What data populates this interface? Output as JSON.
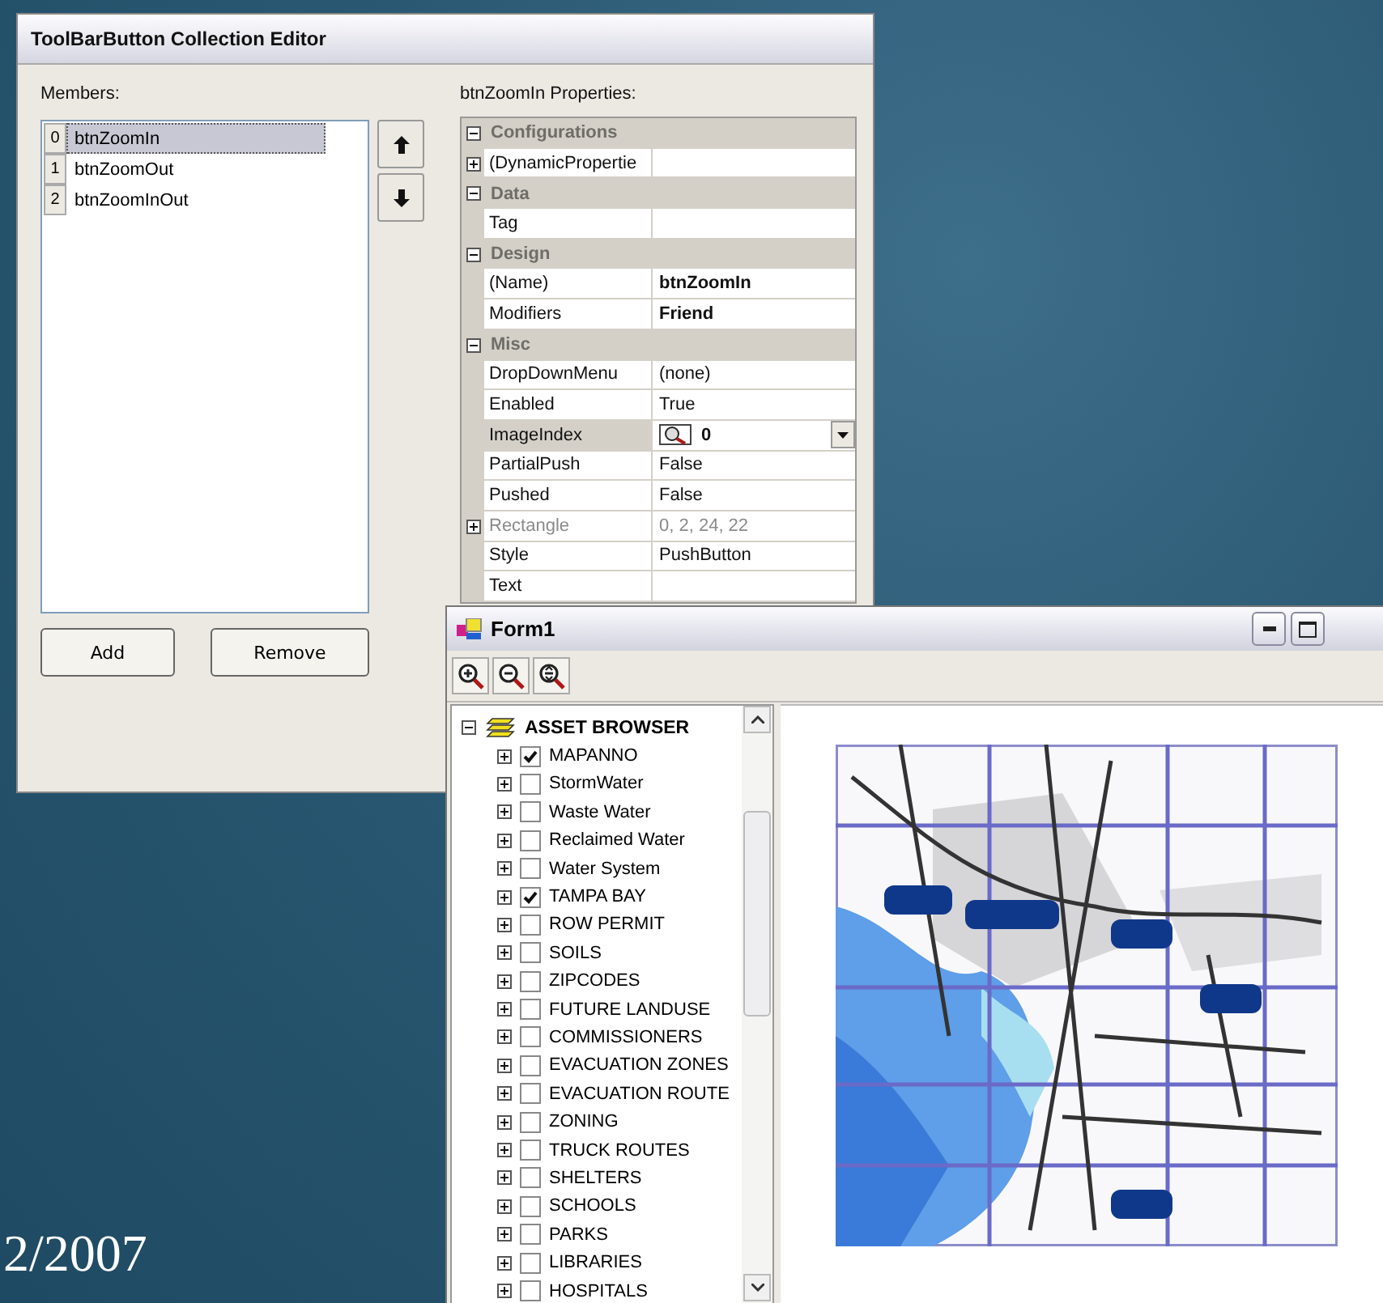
{
  "slide": {
    "date": "2/2007"
  },
  "editor": {
    "title": "ToolBarButton Collection Editor",
    "members_label": "Members:",
    "members": [
      {
        "index": "0",
        "name": "btnZoomIn",
        "selected": true
      },
      {
        "index": "1",
        "name": "btnZoomOut",
        "selected": false
      },
      {
        "index": "2",
        "name": "btnZoomInOut",
        "selected": false
      }
    ],
    "properties_label": "btnZoomIn Properties:",
    "properties": [
      {
        "kind": "category",
        "name": "Configurations",
        "expanded": true
      },
      {
        "kind": "row",
        "name": "(DynamicPropertie",
        "expandable": true,
        "disabled": false,
        "selected": false
      },
      {
        "kind": "category",
        "name": "Data",
        "expanded": true
      },
      {
        "kind": "row",
        "name": "Tag",
        "expandable": false,
        "disabled": false,
        "selected": false
      },
      {
        "kind": "category",
        "name": "Design",
        "expanded": true
      },
      {
        "kind": "row",
        "name": "(Name)",
        "value": "btnZoomIn",
        "expandable": false,
        "bold": true,
        "disabled": false,
        "selected": false
      },
      {
        "kind": "row",
        "name": "Modifiers",
        "value": "Friend",
        "expandable": false,
        "bold": true,
        "disabled": false,
        "selected": false
      },
      {
        "kind": "category",
        "name": "Misc",
        "expanded": true
      },
      {
        "kind": "row",
        "name": "DropDownMenu",
        "value": "(none)",
        "expandable": false,
        "bold": false,
        "disabled": false,
        "selected": false
      },
      {
        "kind": "row",
        "name": "Enabled",
        "value": "True",
        "expandable": false,
        "bold": false,
        "disabled": false,
        "selected": false
      },
      {
        "name": "ImageIndex",
        "value": "0",
        "expandable": false,
        "bold": true,
        "disabled": false,
        "selected": true
      },
      {
        "kind": "row",
        "name": "PartialPush",
        "value": "False",
        "expandable": false,
        "bold": false,
        "disabled": false,
        "selected": false
      },
      {
        "kind": "row",
        "name": "Pushed",
        "value": "False",
        "expandable": false,
        "bold": false,
        "disabled": false,
        "selected": false
      },
      {
        "kind": "row",
        "name": "Rectangle",
        "value": "0, 2, 24, 22",
        "expandable": true,
        "bold": false,
        "disabled": true,
        "selected": false
      },
      {
        "kind": "row",
        "name": "Style",
        "value": "PushButton",
        "expandable": false,
        "bold": false,
        "disabled": false,
        "selected": false
      },
      {
        "kind": "row",
        "name": "Text",
        "expandable": false,
        "disabled": false,
        "selected": false
      }
    ],
    "buttons": [
      "Add",
      "Remove"
    ]
  },
  "form": {
    "title": "Form1",
    "tree": {
      "label": "ASSET BROWSER",
      "expanded": true,
      "children": [
        {
          "label": "MAPANNO",
          "checked": true,
          "expanded": false
        },
        {
          "label": "StormWater",
          "checked": false,
          "expanded": false
        },
        {
          "label": "Waste Water",
          "checked": false,
          "expanded": false
        },
        {
          "label": "Reclaimed Water",
          "checked": false,
          "expanded": false
        },
        {
          "label": "Water System",
          "checked": false,
          "expanded": false
        },
        {
          "label": "TAMPA BAY",
          "checked": true,
          "expanded": false
        },
        {
          "label": "ROW PERMIT",
          "checked": false,
          "expanded": false
        },
        {
          "label": "SOILS",
          "checked": false,
          "expanded": false
        },
        {
          "label": "ZIPCODES",
          "checked": false,
          "expanded": false
        },
        {
          "label": "FUTURE LANDUSE",
          "checked": false,
          "expanded": false
        },
        {
          "label": "COMMISSIONERS",
          "checked": false,
          "expanded": false
        },
        {
          "label": "EVACUATION ZONES",
          "checked": false,
          "expanded": false
        },
        {
          "label": "EVACUATION ROUTE",
          "checked": false,
          "expanded": false
        },
        {
          "label": "ZONING",
          "checked": false,
          "expanded": false
        },
        {
          "label": "TRUCK ROUTES",
          "checked": false,
          "expanded": false
        },
        {
          "label": "SHELTERS",
          "checked": false,
          "expanded": false
        },
        {
          "label": "SCHOOLS",
          "checked": false,
          "expanded": false
        },
        {
          "label": "PARKS",
          "checked": false,
          "expanded": false
        },
        {
          "label": "LIBRARIES",
          "checked": false,
          "expanded": false
        },
        {
          "label": "HOSPITALS",
          "checked": false,
          "expanded": false
        }
      ]
    }
  }
}
